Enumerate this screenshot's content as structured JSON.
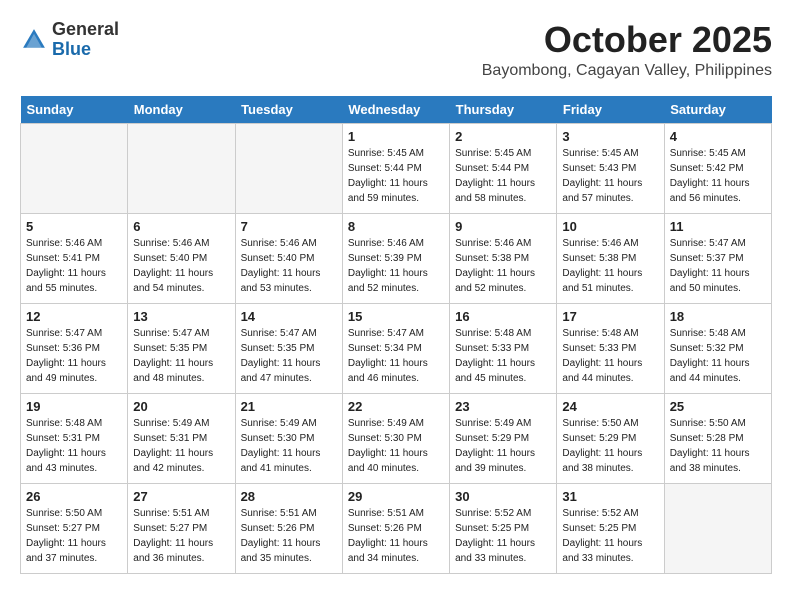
{
  "header": {
    "logo_general": "General",
    "logo_blue": "Blue",
    "month_title": "October 2025",
    "location": "Bayombong, Cagayan Valley, Philippines"
  },
  "weekdays": [
    "Sunday",
    "Monday",
    "Tuesday",
    "Wednesday",
    "Thursday",
    "Friday",
    "Saturday"
  ],
  "weeks": [
    [
      {
        "day": "",
        "sunrise": "",
        "sunset": "",
        "daylight": "",
        "empty": true
      },
      {
        "day": "",
        "sunrise": "",
        "sunset": "",
        "daylight": "",
        "empty": true
      },
      {
        "day": "",
        "sunrise": "",
        "sunset": "",
        "daylight": "",
        "empty": true
      },
      {
        "day": "1",
        "sunrise": "Sunrise: 5:45 AM",
        "sunset": "Sunset: 5:44 PM",
        "daylight": "Daylight: 11 hours and 59 minutes.",
        "empty": false
      },
      {
        "day": "2",
        "sunrise": "Sunrise: 5:45 AM",
        "sunset": "Sunset: 5:44 PM",
        "daylight": "Daylight: 11 hours and 58 minutes.",
        "empty": false
      },
      {
        "day": "3",
        "sunrise": "Sunrise: 5:45 AM",
        "sunset": "Sunset: 5:43 PM",
        "daylight": "Daylight: 11 hours and 57 minutes.",
        "empty": false
      },
      {
        "day": "4",
        "sunrise": "Sunrise: 5:45 AM",
        "sunset": "Sunset: 5:42 PM",
        "daylight": "Daylight: 11 hours and 56 minutes.",
        "empty": false
      }
    ],
    [
      {
        "day": "5",
        "sunrise": "Sunrise: 5:46 AM",
        "sunset": "Sunset: 5:41 PM",
        "daylight": "Daylight: 11 hours and 55 minutes.",
        "empty": false
      },
      {
        "day": "6",
        "sunrise": "Sunrise: 5:46 AM",
        "sunset": "Sunset: 5:40 PM",
        "daylight": "Daylight: 11 hours and 54 minutes.",
        "empty": false
      },
      {
        "day": "7",
        "sunrise": "Sunrise: 5:46 AM",
        "sunset": "Sunset: 5:40 PM",
        "daylight": "Daylight: 11 hours and 53 minutes.",
        "empty": false
      },
      {
        "day": "8",
        "sunrise": "Sunrise: 5:46 AM",
        "sunset": "Sunset: 5:39 PM",
        "daylight": "Daylight: 11 hours and 52 minutes.",
        "empty": false
      },
      {
        "day": "9",
        "sunrise": "Sunrise: 5:46 AM",
        "sunset": "Sunset: 5:38 PM",
        "daylight": "Daylight: 11 hours and 52 minutes.",
        "empty": false
      },
      {
        "day": "10",
        "sunrise": "Sunrise: 5:46 AM",
        "sunset": "Sunset: 5:38 PM",
        "daylight": "Daylight: 11 hours and 51 minutes.",
        "empty": false
      },
      {
        "day": "11",
        "sunrise": "Sunrise: 5:47 AM",
        "sunset": "Sunset: 5:37 PM",
        "daylight": "Daylight: 11 hours and 50 minutes.",
        "empty": false
      }
    ],
    [
      {
        "day": "12",
        "sunrise": "Sunrise: 5:47 AM",
        "sunset": "Sunset: 5:36 PM",
        "daylight": "Daylight: 11 hours and 49 minutes.",
        "empty": false
      },
      {
        "day": "13",
        "sunrise": "Sunrise: 5:47 AM",
        "sunset": "Sunset: 5:35 PM",
        "daylight": "Daylight: 11 hours and 48 minutes.",
        "empty": false
      },
      {
        "day": "14",
        "sunrise": "Sunrise: 5:47 AM",
        "sunset": "Sunset: 5:35 PM",
        "daylight": "Daylight: 11 hours and 47 minutes.",
        "empty": false
      },
      {
        "day": "15",
        "sunrise": "Sunrise: 5:47 AM",
        "sunset": "Sunset: 5:34 PM",
        "daylight": "Daylight: 11 hours and 46 minutes.",
        "empty": false
      },
      {
        "day": "16",
        "sunrise": "Sunrise: 5:48 AM",
        "sunset": "Sunset: 5:33 PM",
        "daylight": "Daylight: 11 hours and 45 minutes.",
        "empty": false
      },
      {
        "day": "17",
        "sunrise": "Sunrise: 5:48 AM",
        "sunset": "Sunset: 5:33 PM",
        "daylight": "Daylight: 11 hours and 44 minutes.",
        "empty": false
      },
      {
        "day": "18",
        "sunrise": "Sunrise: 5:48 AM",
        "sunset": "Sunset: 5:32 PM",
        "daylight": "Daylight: 11 hours and 44 minutes.",
        "empty": false
      }
    ],
    [
      {
        "day": "19",
        "sunrise": "Sunrise: 5:48 AM",
        "sunset": "Sunset: 5:31 PM",
        "daylight": "Daylight: 11 hours and 43 minutes.",
        "empty": false
      },
      {
        "day": "20",
        "sunrise": "Sunrise: 5:49 AM",
        "sunset": "Sunset: 5:31 PM",
        "daylight": "Daylight: 11 hours and 42 minutes.",
        "empty": false
      },
      {
        "day": "21",
        "sunrise": "Sunrise: 5:49 AM",
        "sunset": "Sunset: 5:30 PM",
        "daylight": "Daylight: 11 hours and 41 minutes.",
        "empty": false
      },
      {
        "day": "22",
        "sunrise": "Sunrise: 5:49 AM",
        "sunset": "Sunset: 5:30 PM",
        "daylight": "Daylight: 11 hours and 40 minutes.",
        "empty": false
      },
      {
        "day": "23",
        "sunrise": "Sunrise: 5:49 AM",
        "sunset": "Sunset: 5:29 PM",
        "daylight": "Daylight: 11 hours and 39 minutes.",
        "empty": false
      },
      {
        "day": "24",
        "sunrise": "Sunrise: 5:50 AM",
        "sunset": "Sunset: 5:29 PM",
        "daylight": "Daylight: 11 hours and 38 minutes.",
        "empty": false
      },
      {
        "day": "25",
        "sunrise": "Sunrise: 5:50 AM",
        "sunset": "Sunset: 5:28 PM",
        "daylight": "Daylight: 11 hours and 38 minutes.",
        "empty": false
      }
    ],
    [
      {
        "day": "26",
        "sunrise": "Sunrise: 5:50 AM",
        "sunset": "Sunset: 5:27 PM",
        "daylight": "Daylight: 11 hours and 37 minutes.",
        "empty": false
      },
      {
        "day": "27",
        "sunrise": "Sunrise: 5:51 AM",
        "sunset": "Sunset: 5:27 PM",
        "daylight": "Daylight: 11 hours and 36 minutes.",
        "empty": false
      },
      {
        "day": "28",
        "sunrise": "Sunrise: 5:51 AM",
        "sunset": "Sunset: 5:26 PM",
        "daylight": "Daylight: 11 hours and 35 minutes.",
        "empty": false
      },
      {
        "day": "29",
        "sunrise": "Sunrise: 5:51 AM",
        "sunset": "Sunset: 5:26 PM",
        "daylight": "Daylight: 11 hours and 34 minutes.",
        "empty": false
      },
      {
        "day": "30",
        "sunrise": "Sunrise: 5:52 AM",
        "sunset": "Sunset: 5:25 PM",
        "daylight": "Daylight: 11 hours and 33 minutes.",
        "empty": false
      },
      {
        "day": "31",
        "sunrise": "Sunrise: 5:52 AM",
        "sunset": "Sunset: 5:25 PM",
        "daylight": "Daylight: 11 hours and 33 minutes.",
        "empty": false
      },
      {
        "day": "",
        "sunrise": "",
        "sunset": "",
        "daylight": "",
        "empty": true
      }
    ]
  ]
}
